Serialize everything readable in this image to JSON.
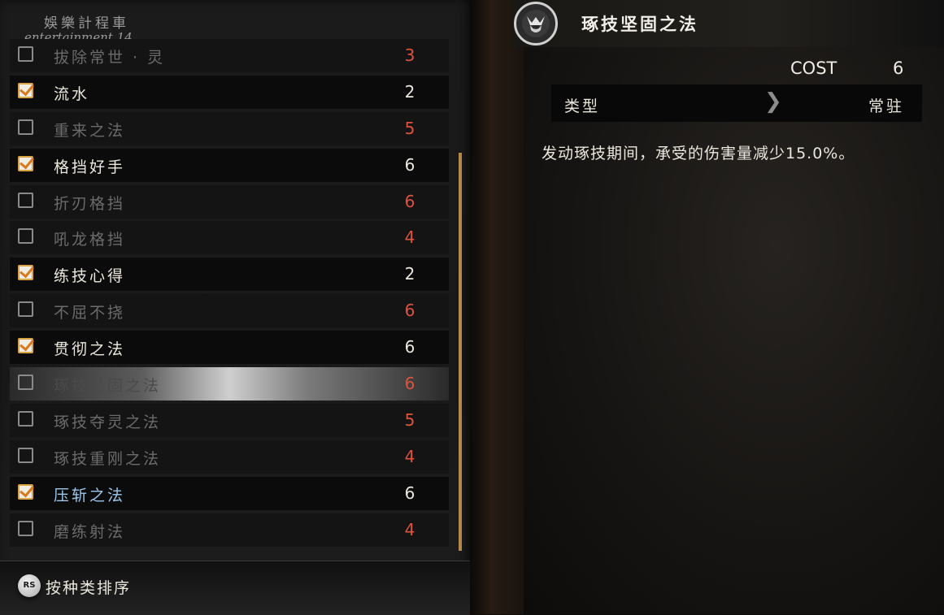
{
  "watermark": {
    "line1": "娛樂計程車",
    "line2": "entertainment 14"
  },
  "skills": [
    {
      "name": "拔除常世 · 灵",
      "cost": "3",
      "checked": false,
      "style": "dim",
      "cost_color": "red"
    },
    {
      "name": "流水",
      "cost": "2",
      "checked": true,
      "style": "active",
      "cost_color": "white"
    },
    {
      "name": "重来之法",
      "cost": "5",
      "checked": false,
      "style": "dim",
      "cost_color": "red"
    },
    {
      "name": "格挡好手",
      "cost": "6",
      "checked": true,
      "style": "active",
      "cost_color": "white"
    },
    {
      "name": "折刃格挡",
      "cost": "6",
      "checked": false,
      "style": "dim",
      "cost_color": "red"
    },
    {
      "name": "吼龙格挡",
      "cost": "4",
      "checked": false,
      "style": "dim",
      "cost_color": "red"
    },
    {
      "name": "练技心得",
      "cost": "2",
      "checked": true,
      "style": "active",
      "cost_color": "white"
    },
    {
      "name": "不屈不挠",
      "cost": "6",
      "checked": false,
      "style": "dim",
      "cost_color": "red"
    },
    {
      "name": "贯彻之法",
      "cost": "6",
      "checked": true,
      "style": "active",
      "cost_color": "white"
    },
    {
      "name": "琢技坚固之法",
      "cost": "6",
      "checked": false,
      "style": "selected",
      "cost_color": "red"
    },
    {
      "name": "琢技夺灵之法",
      "cost": "5",
      "checked": false,
      "style": "dim",
      "cost_color": "red"
    },
    {
      "name": "琢技重刚之法",
      "cost": "4",
      "checked": false,
      "style": "dim",
      "cost_color": "red"
    },
    {
      "name": "压斩之法",
      "cost": "6",
      "checked": true,
      "style": "blue",
      "cost_color": "white"
    },
    {
      "name": "磨练射法",
      "cost": "4",
      "checked": false,
      "style": "dim",
      "cost_color": "red"
    }
  ],
  "footer": {
    "button_glyph": "RS",
    "sort_label": "按种类排序"
  },
  "detail": {
    "emblem_icon": "samurai-helmet-icon",
    "title": "琢技坚固之法",
    "cost_label": "COST",
    "cost_value": "6",
    "type_label": "类型",
    "type_value": "常驻",
    "description": "发动琢技期间，承受的伤害量减少15.0%。"
  },
  "colors": {
    "cost_red": "#e0523c",
    "check_orange": "#d77a1c",
    "scrollbar": "#b7864a",
    "highlight_blue": "#9cc6ec"
  }
}
